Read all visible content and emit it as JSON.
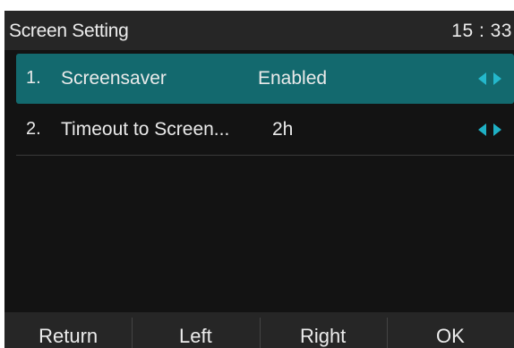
{
  "header": {
    "title": "Screen Setting",
    "clock": "15 : 33"
  },
  "settings": [
    {
      "index": "1.",
      "label": "Screensaver",
      "value": "Enabled",
      "selected": true
    },
    {
      "index": "2.",
      "label": "Timeout to Screen...",
      "value": "2h",
      "selected": false
    }
  ],
  "softkeys": {
    "return": "Return",
    "left": "Left",
    "right": "Right",
    "ok": "OK"
  },
  "colors": {
    "selection": "#13696e",
    "arrow_accent": "#1fb0c4",
    "background": "#131313",
    "bar": "#262626"
  },
  "icons": [
    "left-arrow-icon",
    "right-arrow-icon"
  ]
}
